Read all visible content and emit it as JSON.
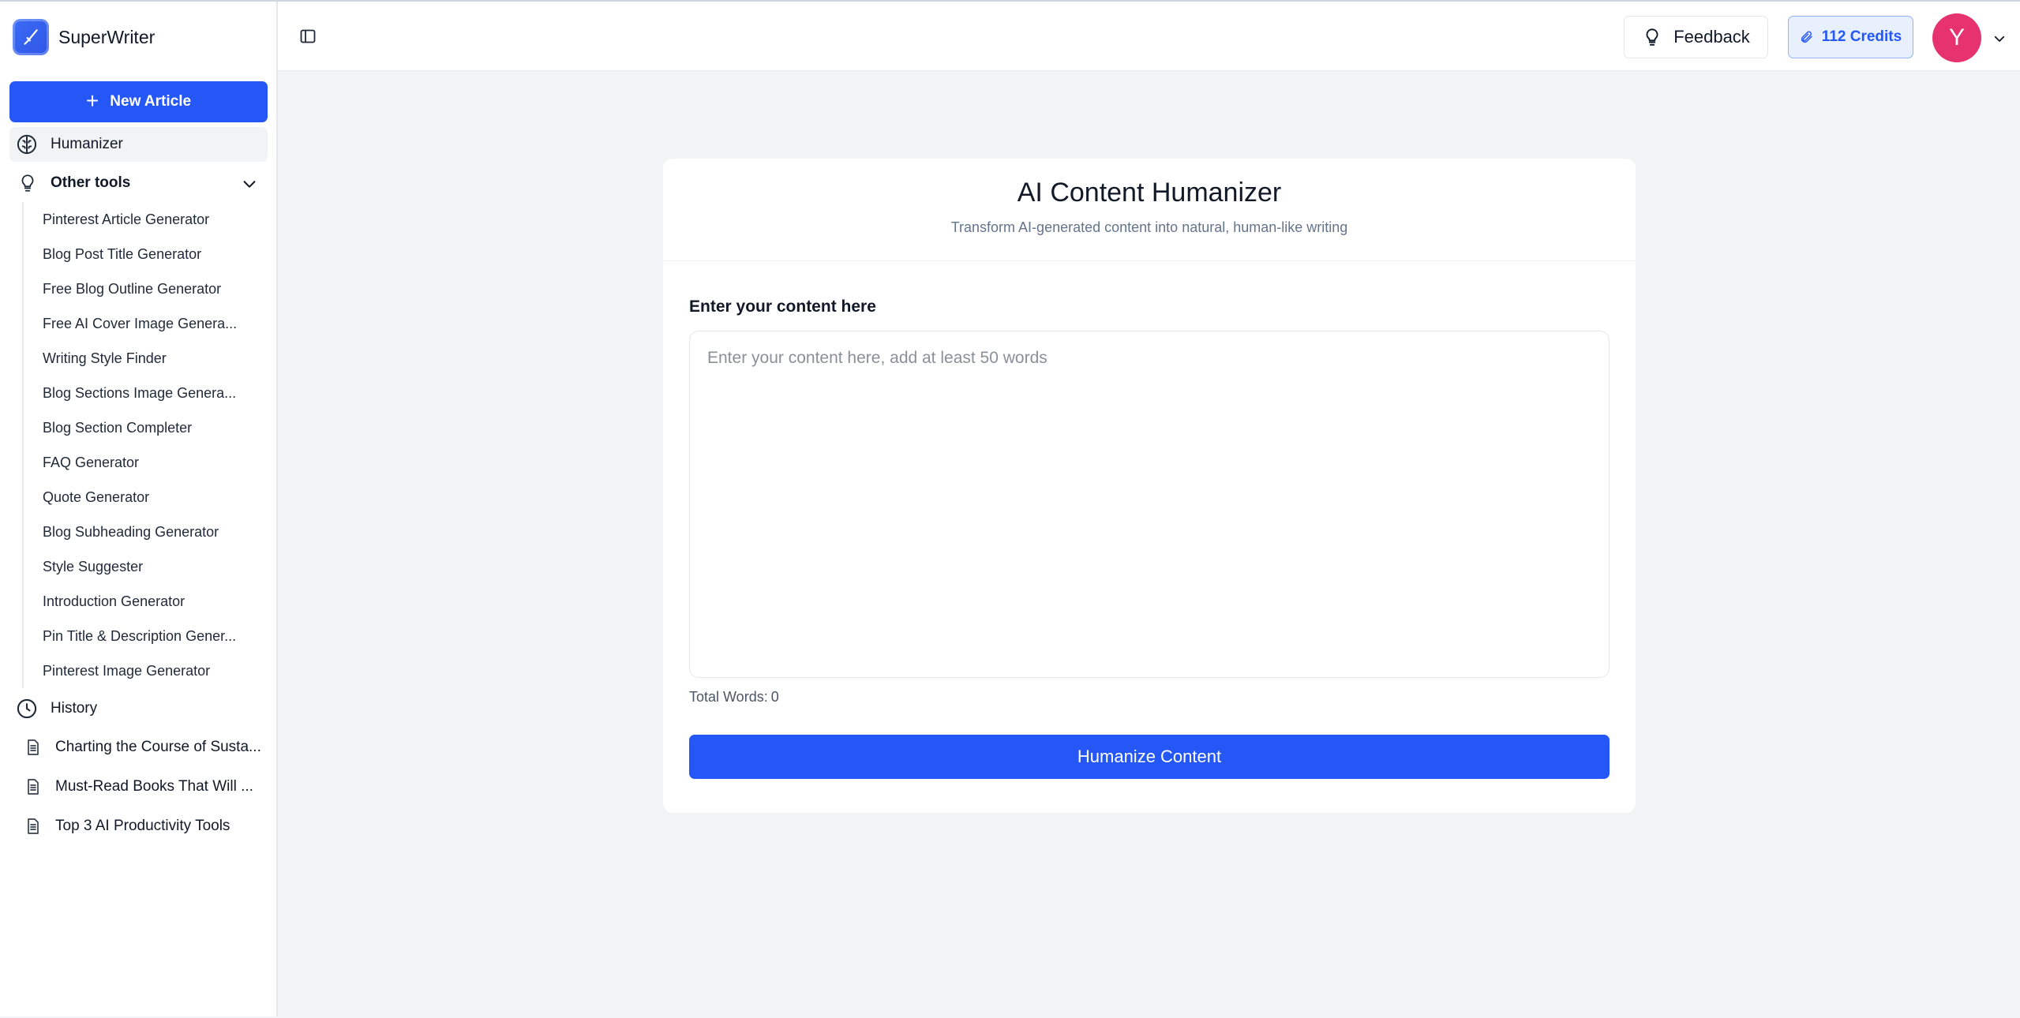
{
  "app": {
    "name": "SuperWriter"
  },
  "sidebar": {
    "new_article_label": "New Article",
    "humanizer_label": "Humanizer",
    "other_tools_label": "Other tools",
    "tools": [
      "Pinterest Article Generator",
      "Blog Post Title Generator",
      "Free Blog Outline Generator",
      "Free AI Cover Image Genera...",
      "Writing Style Finder",
      "Blog Sections Image Genera...",
      "Blog Section Completer",
      "FAQ Generator",
      "Quote Generator",
      "Blog Subheading Generator",
      "Style Suggester",
      "Introduction Generator",
      "Pin Title & Description Gener...",
      "Pinterest Image Generator"
    ],
    "history_label": "History",
    "history": [
      "Charting the Course of Susta...",
      "Must-Read Books That Will ...",
      "Top 3 AI Productivity Tools"
    ]
  },
  "header": {
    "feedback_label": "Feedback",
    "credits_label": "112 Credits",
    "avatar_initial": "Y"
  },
  "main": {
    "title": "AI Content Humanizer",
    "subtitle": "Transform AI-generated content into natural, human-like writing",
    "field_label": "Enter your content here",
    "textarea_placeholder": "Enter your content here, add at least 50 words",
    "textarea_value": "",
    "word_count_label": "Total Words:",
    "word_count": "0",
    "submit_label": "Humanize Content"
  },
  "colors": {
    "accent": "#2457f5",
    "avatar": "#e6336f",
    "background": "#f1f3f7"
  }
}
